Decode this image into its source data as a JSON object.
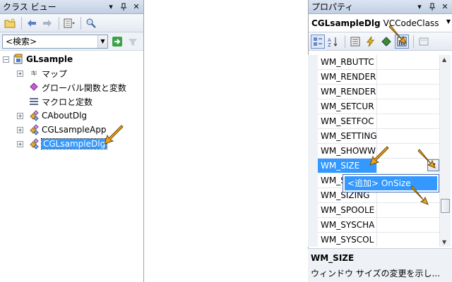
{
  "class_view": {
    "title": "クラス ビュー",
    "search_placeholder": "<検索>",
    "tree": [
      {
        "label": "GLsample",
        "bold": true
      },
      {
        "label": "マップ"
      },
      {
        "label": "グローバル関数と変数"
      },
      {
        "label": "マクロと定数"
      },
      {
        "label": "CAboutDlg"
      },
      {
        "label": "CGLsampleApp"
      },
      {
        "label": "CGLsampleDlg",
        "selected": true
      }
    ]
  },
  "properties": {
    "title": "プロパティ",
    "object_name": "CGLsampleDlg",
    "object_type": "VCCodeClass",
    "rows": [
      "WM_RBUTTC",
      "WM_RENDER",
      "WM_RENDER",
      "WM_SETCUR",
      "WM_SETFOC",
      "WM_SETTING",
      "WM_SHOWW",
      "WM_SIZE",
      "WM_S",
      "WM_SIZING",
      "WM_SPOOLE",
      "WM_SYSCHA",
      "WM_SYSCOL"
    ],
    "popup_item": "<追加> OnSize",
    "description_title": "WM_SIZE",
    "description_text": "ウィンドウ サイズの変更を示し..."
  },
  "colors": {
    "selection": "#3399ff",
    "accent_arrow": "#f2a31b"
  }
}
